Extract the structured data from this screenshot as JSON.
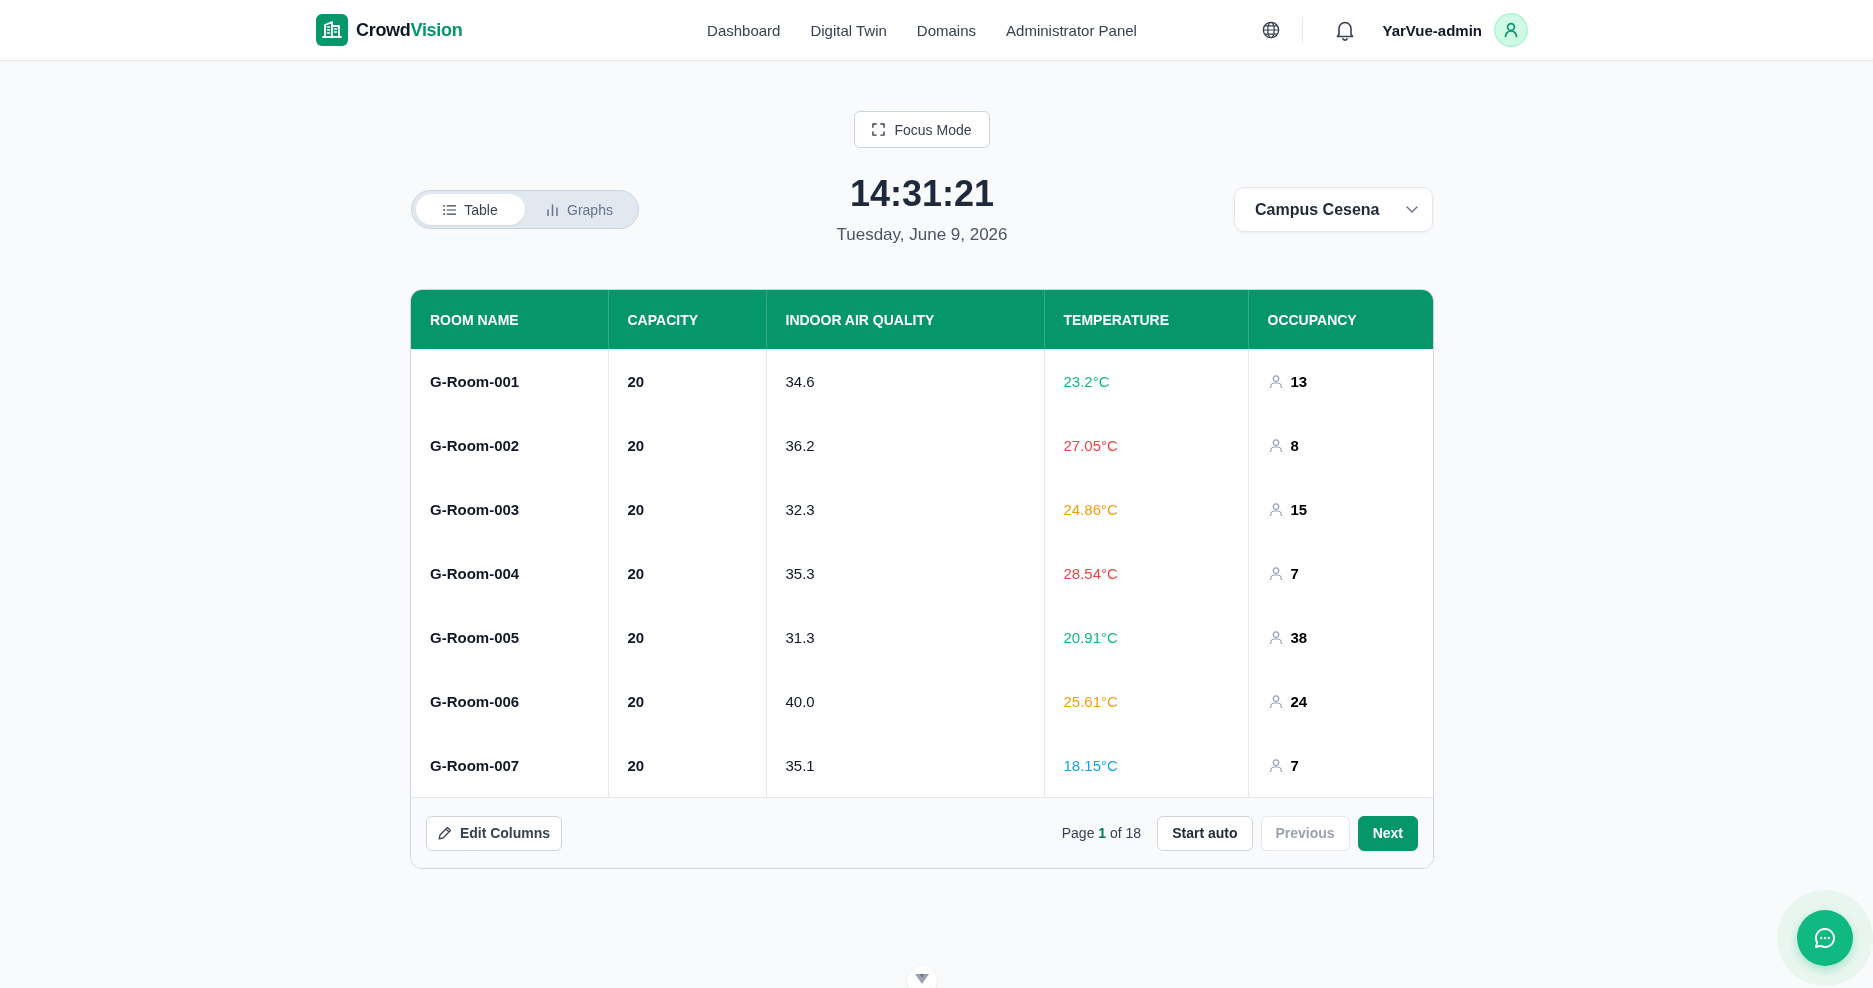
{
  "header": {
    "brand": {
      "name": "Crowd",
      "accent": "Vision"
    },
    "nav": [
      "Dashboard",
      "Digital Twin",
      "Domains",
      "Administrator Panel"
    ],
    "user": {
      "name": "YarVue-admin"
    }
  },
  "focus_button": {
    "label": "Focus Mode"
  },
  "view_toggle": [
    {
      "label": "Table",
      "kind": "table",
      "selected": true
    },
    {
      "label": "Graphs",
      "kind": "graphs",
      "selected": false
    }
  ],
  "clock": {
    "time": "14:31:21",
    "date": "Tuesday, June 9, 2026"
  },
  "campus_select": {
    "value": "Campus Cesena"
  },
  "table": {
    "columns": [
      "ROOM NAME",
      "CAPACITY",
      "INDOOR AIR QUALITY",
      "TEMPERATURE",
      "OCCUPANCY"
    ],
    "rows": [
      {
        "room": "G-Room-001",
        "capacity": "20",
        "air_quality": "34.6",
        "temperature": {
          "value": "23.2°C",
          "color": "#10b981"
        },
        "occupancy": "13"
      },
      {
        "room": "G-Room-002",
        "capacity": "20",
        "air_quality": "36.2",
        "temperature": {
          "value": "27.05°C",
          "color": "#ef4444"
        },
        "occupancy": "8"
      },
      {
        "room": "G-Room-003",
        "capacity": "20",
        "air_quality": "32.3",
        "temperature": {
          "value": "24.86°C",
          "color": "#f59e0b"
        },
        "occupancy": "15"
      },
      {
        "room": "G-Room-004",
        "capacity": "20",
        "air_quality": "35.3",
        "temperature": {
          "value": "28.54°C",
          "color": "#ef4444"
        },
        "occupancy": "7"
      },
      {
        "room": "G-Room-005",
        "capacity": "20",
        "air_quality": "31.3",
        "temperature": {
          "value": "20.91°C",
          "color": "#10b981"
        },
        "occupancy": "38"
      },
      {
        "room": "G-Room-006",
        "capacity": "20",
        "air_quality": "40.0",
        "temperature": {
          "value": "25.61°C",
          "color": "#f59e0b"
        },
        "occupancy": "24"
      },
      {
        "room": "G-Room-007",
        "capacity": "20",
        "air_quality": "35.1",
        "temperature": {
          "value": "18.15°C",
          "color": "#0ea5e9"
        },
        "occupancy": "7"
      }
    ]
  },
  "footer": {
    "edit_button": "Edit Columns",
    "page_info": "Page **1** of 18",
    "buttons": [
      {
        "label": "Start auto",
        "kind": "outline",
        "disabled": false
      },
      {
        "label": "Previous",
        "kind": "outline",
        "disabled": true
      },
      {
        "label": "Next",
        "kind": "primary",
        "disabled": false
      }
    ]
  }
}
